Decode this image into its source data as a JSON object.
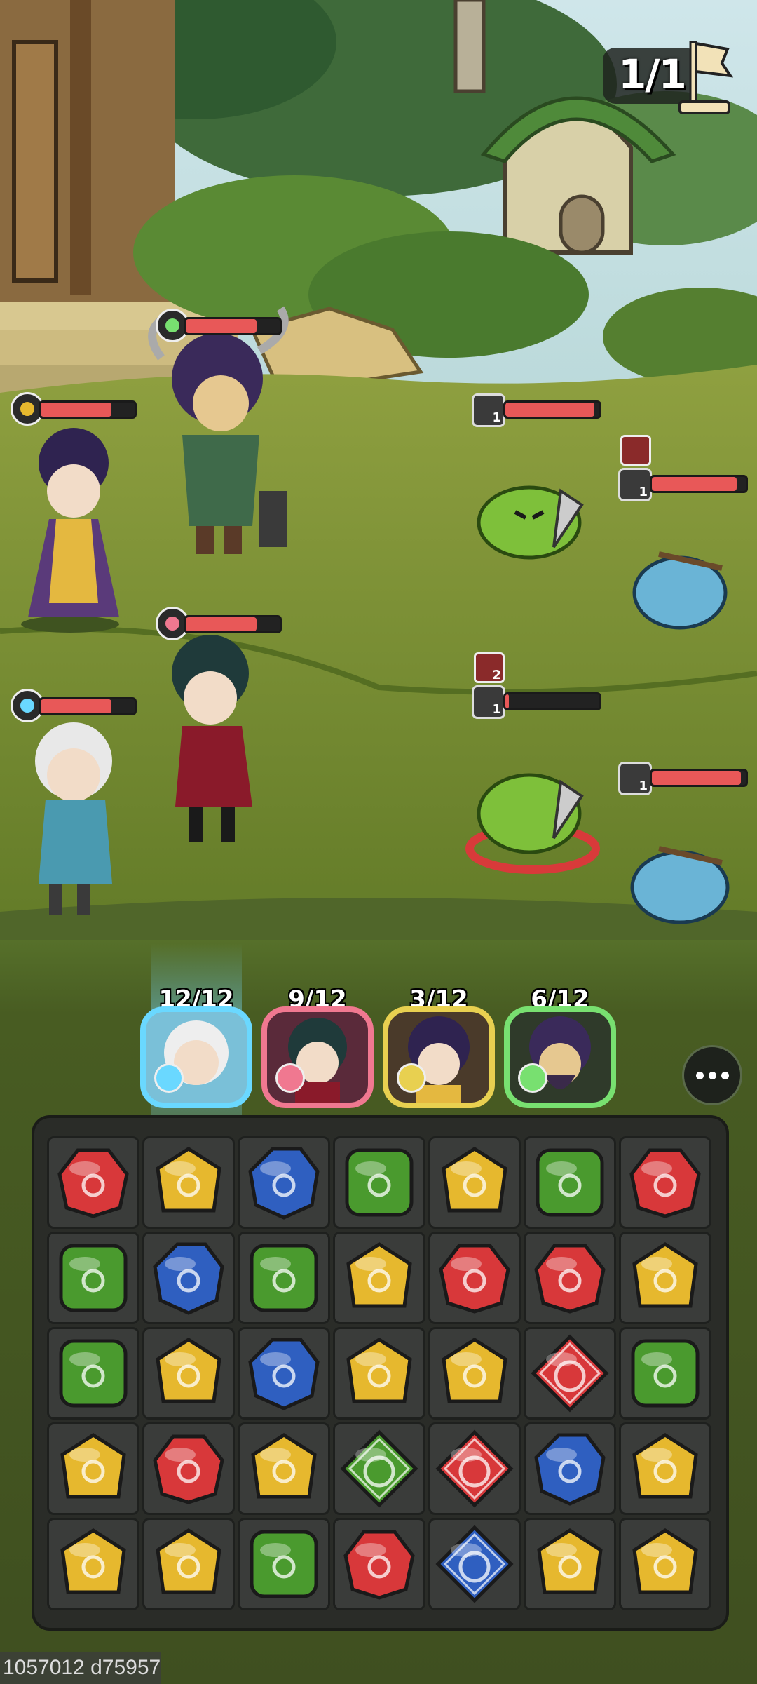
{
  "wave": {
    "text": "1/1"
  },
  "heroes_on_field": [
    {
      "name": "archer-girl",
      "element": "earth",
      "hp": 0.75
    },
    {
      "name": "horned-warrior",
      "element": "wind",
      "hp": 0.75
    },
    {
      "name": "swordsman",
      "element": "fire",
      "hp": 0.75
    },
    {
      "name": "alchemist",
      "element": "water",
      "hp": 0.75
    }
  ],
  "enemies": [
    {
      "name": "green-slime-top",
      "badge_count": "1",
      "hp": 0.95
    },
    {
      "name": "blue-slime-top",
      "badge_count": "1",
      "hp": 0.9
    },
    {
      "name": "green-slime-targeted",
      "badge_count": "1",
      "hp": 0.0,
      "debuff_count": "2"
    },
    {
      "name": "blue-slime-bottom",
      "badge_count": "1",
      "hp": 0.95
    }
  ],
  "team": [
    {
      "charge": "12/12",
      "element": "water",
      "color": "#6ad8ff"
    },
    {
      "charge": "9/12",
      "element": "fire",
      "color": "#f07890"
    },
    {
      "charge": "3/12",
      "element": "earth",
      "color": "#e8d050"
    },
    {
      "charge": "6/12",
      "element": "wind",
      "color": "#78e070"
    }
  ],
  "board": [
    [
      "fire",
      "earth",
      "water",
      "wind",
      "earth",
      "wind",
      "fire"
    ],
    [
      "wind",
      "water",
      "wind",
      "earth",
      "fire",
      "fire",
      "earth"
    ],
    [
      "wind",
      "earth",
      "water",
      "earth",
      "earth",
      "fire-special",
      "wind"
    ],
    [
      "earth",
      "fire",
      "earth",
      "wind-special",
      "fire-special",
      "water",
      "earth"
    ],
    [
      "earth",
      "earth",
      "wind",
      "fire",
      "water-special",
      "earth",
      "earth"
    ]
  ],
  "colors": {
    "fire": "#d8383a",
    "earth": "#e6b82e",
    "water": "#2f5fc0",
    "wind": "#4a9a2e"
  },
  "watermark": "1057012 d75957"
}
